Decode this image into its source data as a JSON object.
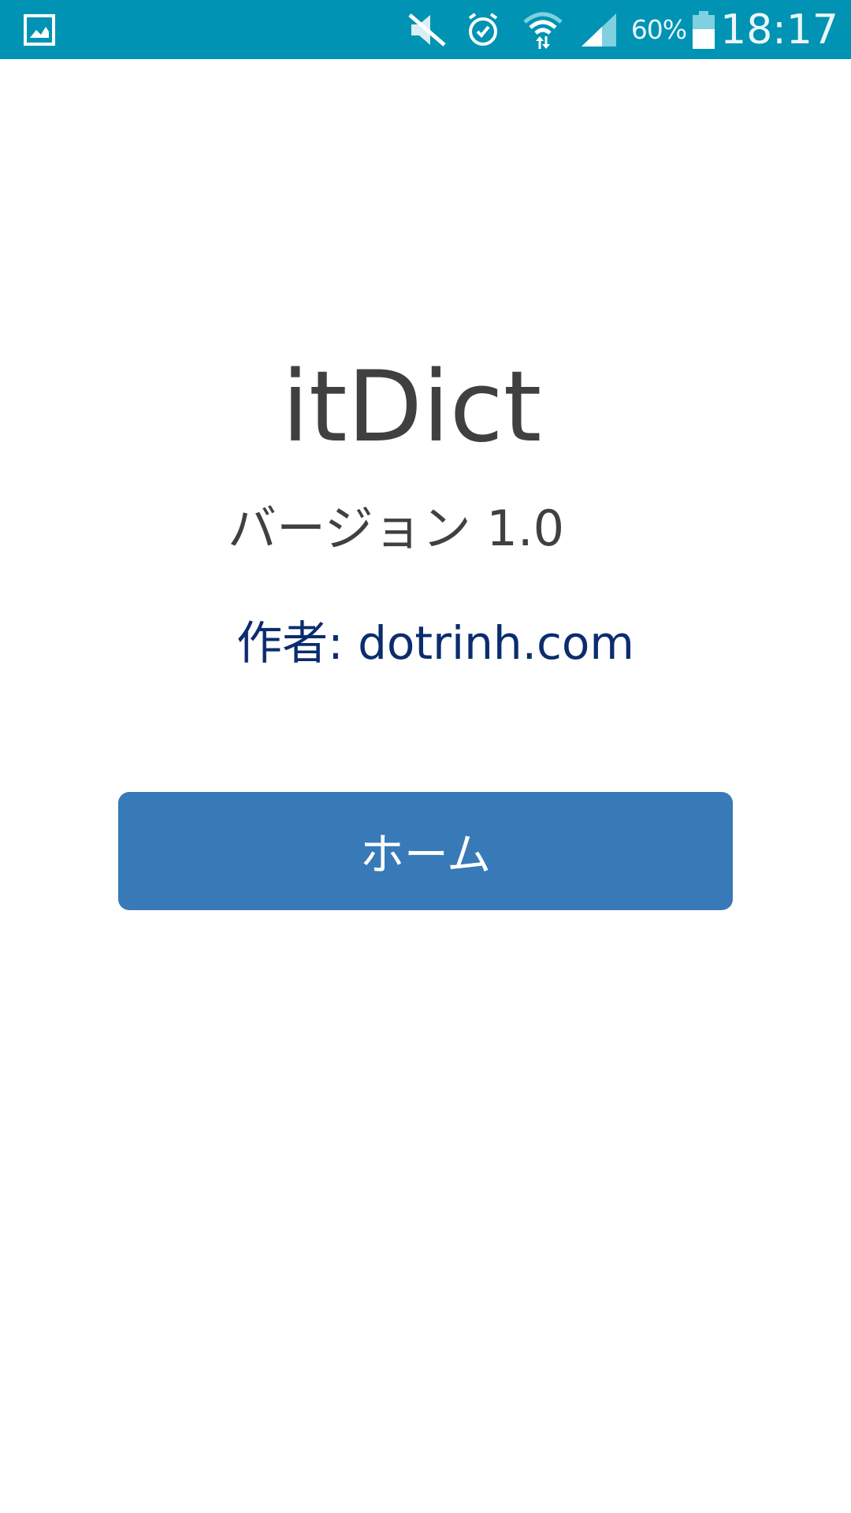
{
  "status_bar": {
    "icons": [
      "gallery-icon",
      "mute-icon",
      "alarm-icon",
      "wifi-icon",
      "signal-icon",
      "battery-icon"
    ],
    "battery_percent": "60%",
    "time": "18:17",
    "background_color": "#0093b3"
  },
  "about": {
    "app_name": "itDict",
    "version": "バージョン 1.0",
    "author": "作者: dotrinh.com"
  },
  "actions": {
    "home_label": "ホーム",
    "button_color": "#377ab7"
  }
}
